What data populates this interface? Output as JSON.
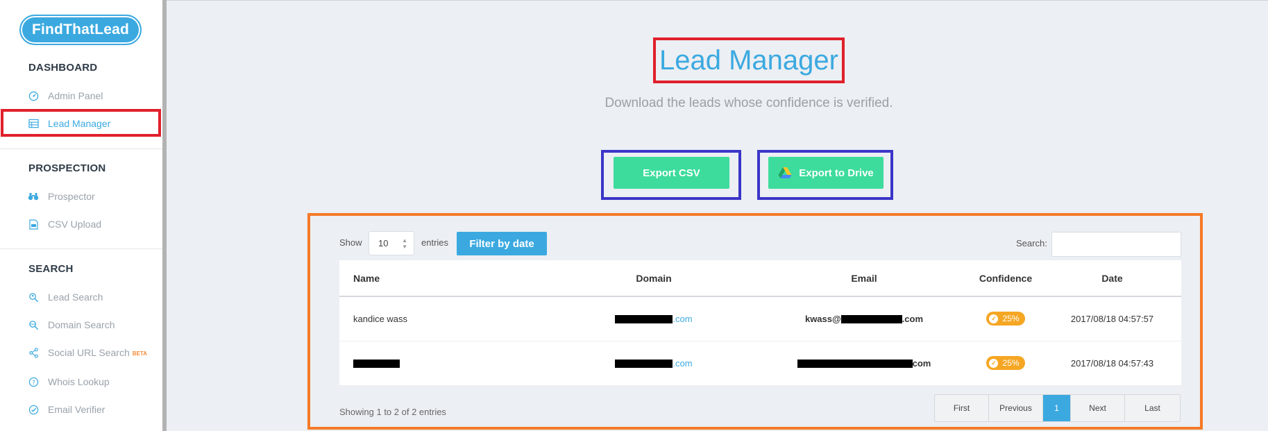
{
  "app": {
    "logo_text": "FindThatLead"
  },
  "sidebar": {
    "sections": [
      {
        "title": "DASHBOARD"
      },
      {
        "title": "PROSPECTION"
      },
      {
        "title": "SEARCH"
      }
    ],
    "items": [
      {
        "label": "Admin Panel",
        "icon": "dashboard-gauge-icon"
      },
      {
        "label": "Lead Manager",
        "icon": "table-list-icon",
        "active": true
      },
      {
        "label": "Prospector",
        "icon": "binoculars-icon"
      },
      {
        "label": "CSV Upload",
        "icon": "file-csv-icon"
      },
      {
        "label": "Lead Search",
        "icon": "magnifier-person-icon"
      },
      {
        "label": "Domain Search",
        "icon": "magnifier-globe-icon"
      },
      {
        "label": "Social URL Search",
        "icon": "share-nodes-icon",
        "badge": "BETA"
      },
      {
        "label": "Whois Lookup",
        "icon": "question-circle-icon"
      },
      {
        "label": "Email Verifier",
        "icon": "check-circle-icon"
      }
    ]
  },
  "main": {
    "title": "Lead Manager",
    "subtitle": "Download the leads whose confidence is verified.",
    "export_csv_label": "Export CSV",
    "export_drive_label": "Export to Drive"
  },
  "table_controls": {
    "show_label": "Show",
    "entries_value": "10",
    "entries_label": "entries",
    "filter_label": "Filter by date",
    "search_label": "Search:",
    "search_value": ""
  },
  "table": {
    "columns": [
      "Name",
      "Domain",
      "Email",
      "Confidence",
      "Date"
    ],
    "rows": [
      {
        "name": "kandice wass",
        "domain_suffix": ".com",
        "email_prefix": "kwass@",
        "email_suffix": ".com",
        "confidence": "25%",
        "date": "2017/08/18 04:57:57"
      },
      {
        "name": "",
        "domain_suffix": ".com",
        "email_prefix": "",
        "email_suffix": "com",
        "confidence": "25%",
        "date": "2017/08/18 04:57:43"
      }
    ]
  },
  "footer": {
    "showing_text": "Showing 1 to 2 of 2 entries",
    "pagination": [
      "First",
      "Previous",
      "1",
      "Next",
      "Last"
    ]
  },
  "colors": {
    "accent": "#3ba9e0",
    "button_green": "#3ddc9c",
    "badge_orange": "#f5a623",
    "highlight_red": "#e0202b",
    "highlight_blue": "#3b35c8",
    "highlight_orange": "#f57a27"
  }
}
